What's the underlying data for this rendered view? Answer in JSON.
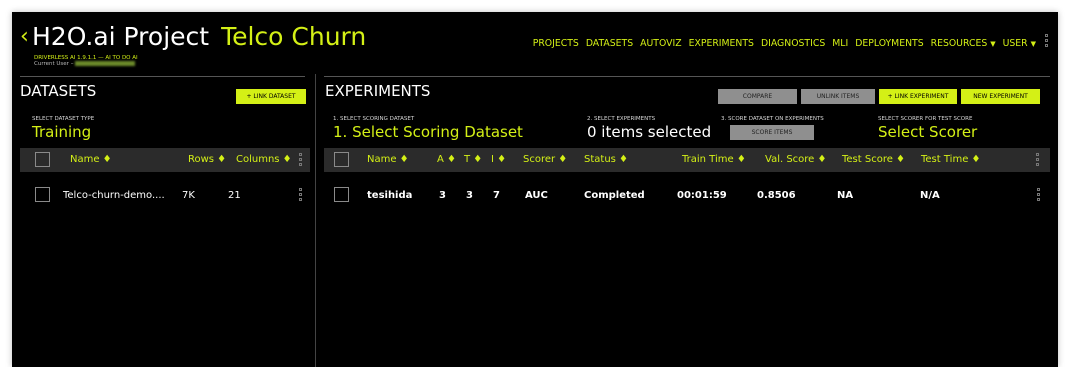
{
  "header": {
    "back_icon": "chevron-left-icon",
    "app_name": "H2O.ai Project",
    "project_name": "Telco Churn",
    "version": "DRIVERLESS AI 1.9.1.1 — AI TO DO AI",
    "current_user_label": "Current User –"
  },
  "nav": [
    {
      "label": "PROJECTS"
    },
    {
      "label": "DATASETS"
    },
    {
      "label": "AUTOVIZ"
    },
    {
      "label": "EXPERIMENTS"
    },
    {
      "label": "DIAGNOSTICS"
    },
    {
      "label": "MLI"
    },
    {
      "label": "DEPLOYMENTS"
    },
    {
      "label": "RESOURCES",
      "caret": "▼"
    },
    {
      "label": "USER",
      "caret": "▼"
    }
  ],
  "datasets": {
    "title": "DATASETS",
    "link_button": "+ LINK DATASET",
    "type_label": "SELECT DATASET TYPE",
    "type_value": "Training",
    "columns": [
      "Name ♦",
      "Rows ♦",
      "Columns ♦"
    ],
    "rows": [
      {
        "name": "Telco-churn-demo....",
        "rows": "7K",
        "columns": "21"
      }
    ]
  },
  "experiments": {
    "title": "EXPERIMENTS",
    "compare_button": "COMPARE",
    "unlink_button": "UNLINK ITEMS",
    "link_button": "+ LINK EXPERIMENT",
    "new_button": "NEW EXPERIMENT",
    "step1_label": "1. SELECT SCORING DATASET",
    "step1_value": "1. Select Scoring Dataset",
    "step2_label": "2. SELECT EXPERIMENTS",
    "step2_value": "0 items selected",
    "step3_label": "3. SCORE DATASET ON EXPERIMENTS",
    "score_button": "SCORE ITEMS",
    "scorer_label": "SELECT SCORER FOR TEST SCORE",
    "scorer_value": "Select Scorer",
    "columns": [
      "Name ♦",
      "A ♦",
      "T ♦",
      "I ♦",
      "Scorer ♦",
      "Status ♦",
      "Train Time ♦",
      "Val. Score ♦",
      "Test Score ♦",
      "Test Time ♦"
    ],
    "rows": [
      {
        "name": "tesihida",
        "a": "3",
        "t": "3",
        "i": "7",
        "scorer": "AUC",
        "status": "Completed",
        "train_time": "00:01:59",
        "val_score": "0.8506",
        "test_score": "NA",
        "test_time": "N/A"
      }
    ]
  },
  "colors": {
    "accent": "#d4f016",
    "background": "#000000",
    "table_header": "#2b2b2b"
  }
}
